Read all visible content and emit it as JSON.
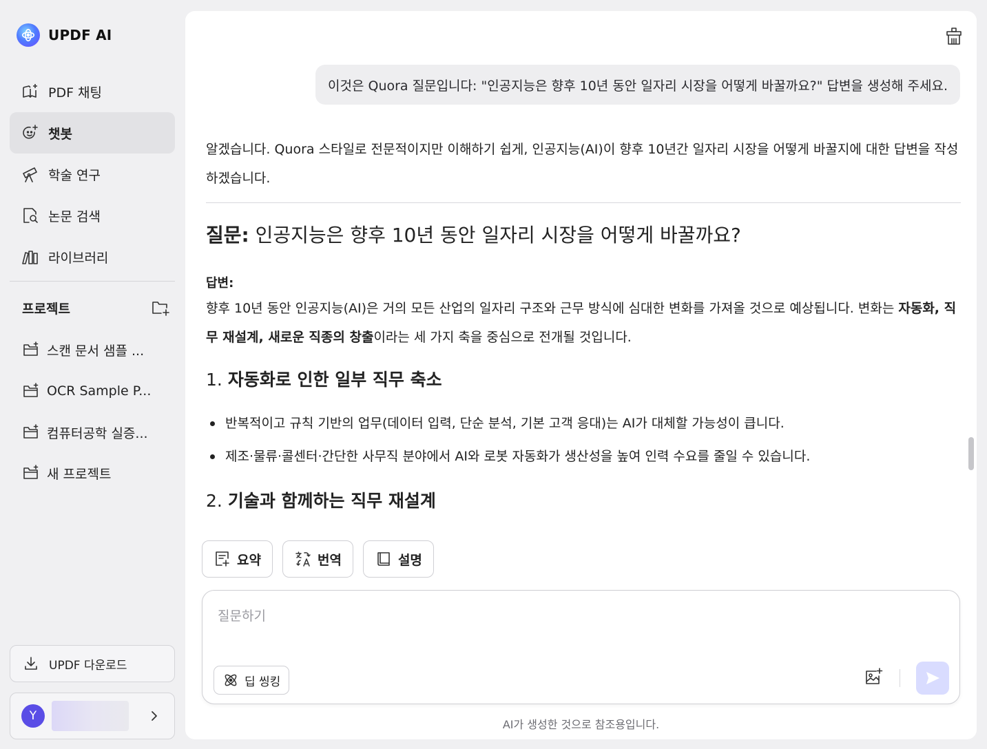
{
  "brand": {
    "name": "UPDF AI"
  },
  "nav": [
    {
      "label": "PDF 채팅",
      "icon": "book-sparkle-icon"
    },
    {
      "label": "챗봇",
      "icon": "chatbot-smile-icon",
      "active": true
    },
    {
      "label": "학술 연구",
      "icon": "telescope-icon"
    },
    {
      "label": "논문 검색",
      "icon": "document-search-icon"
    },
    {
      "label": "라이브러리",
      "icon": "library-books-icon"
    }
  ],
  "projects": {
    "title": "프로젝트",
    "items": [
      {
        "label": "스캔 문서 샘플 ..."
      },
      {
        "label": "OCR Sample P..."
      },
      {
        "label": "컴퓨터공학 실증..."
      },
      {
        "label": "새 프로젝트"
      }
    ]
  },
  "download": {
    "label": "UPDF 다운로드"
  },
  "user": {
    "initial": "Y"
  },
  "chat": {
    "user_message": "이것은 Quora 질문입니다: \"인공지능은 향후 10년 동안 일자리 시장을 어떻게 바꿀까요?\" 답변을 생성해 주세요.",
    "intro": "알겠습니다. Quora 스타일로 전문적이지만 이해하기 쉽게, 인공지능(AI)이 향후 10년간 일자리 시장을 어떻게 바꿀지에 대한 답변을 작성하겠습니다.",
    "question_label": "질문:",
    "question_text": " 인공지능은 향후 10년 동안 일자리 시장을 어떻게 바꿀까요?",
    "answer_label": "답변:",
    "answer_p1": "향후 10년 동안 인공지능(AI)은 거의 모든 산업의 일자리 구조와 근무 방식에 심대한 변화를 가져올 것으로 예상됩니다. 변화는 ",
    "answer_bold": "자동화, 직무 재설계, 새로운 직종의 창출",
    "answer_p2": "이라는 세 가지 축을 중심으로 전개될 것입니다.",
    "section1_num": "1. ",
    "section1_title": "자동화로 인한 일부 직무 축소",
    "bullets": [
      "반복적이고 규칙 기반의 업무(데이터 입력, 단순 분석, 기본 고객 응대)는 AI가 대체할 가능성이 큽니다.",
      "제조·물류·콜센터·간단한 사무직 분야에서 AI와 로봇 자동화가 생산성을 높여 인력 수요를 줄일 수 있습니다."
    ],
    "section2_num": "2. ",
    "section2_title": "기술과 함께하는 직무 재설계"
  },
  "quick_actions": [
    {
      "label": "요약",
      "icon": "summarize-icon"
    },
    {
      "label": "번역",
      "icon": "translate-icon"
    },
    {
      "label": "설명",
      "icon": "explain-book-icon"
    }
  ],
  "composer": {
    "placeholder": "질문하기",
    "deep_think_label": "딥 씽킹"
  },
  "disclaimer": "AI가 생성한 것으로 참조용입니다.",
  "colors": {
    "accent": "#5a4de6",
    "send_disabled": "#d9dcff",
    "active_nav": "#e2e2e5"
  }
}
